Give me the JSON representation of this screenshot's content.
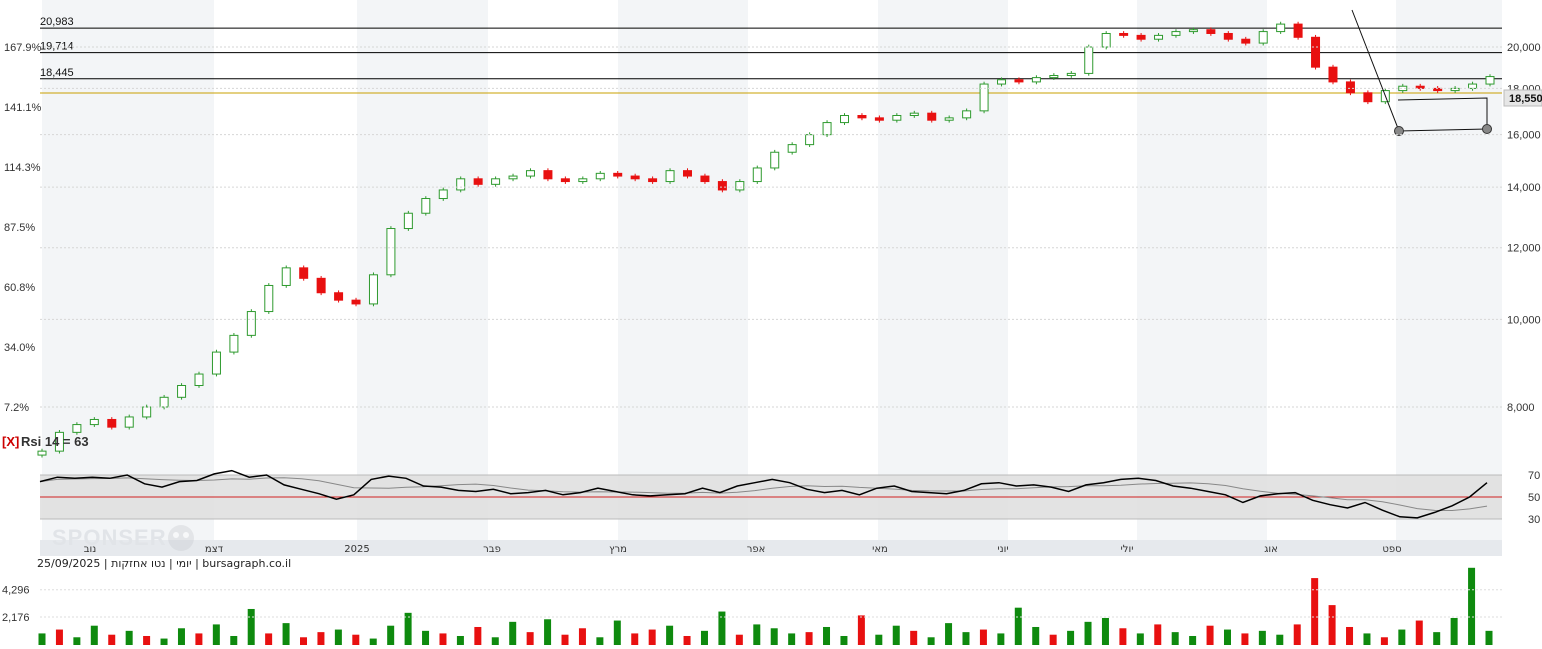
{
  "info_line": "יומי | נטו אחזקות | 25/09/2025 | bursagraph.co.il",
  "watermark": "SPONSER",
  "last_price": "18,550",
  "rsi_label": "Rsi 14 = 63",
  "rsi_close_mark": "[X]",
  "colors": {
    "up": "#2e9a2e",
    "down": "#e81010",
    "vol_up": "#0e8a0e",
    "vol_down": "#e81010",
    "level_line": "#000000",
    "last_line": "#c8a000",
    "rsi_mid": "#d02020",
    "band": "#dedede"
  },
  "chart_data": {
    "type": "candlestick",
    "price_axis": {
      "scale": "log",
      "ticks": [
        "8,000",
        "10,000",
        "12,000",
        "14,000",
        "16,000",
        "18,000",
        "20,000"
      ],
      "tick_values": [
        8000,
        10000,
        12000,
        14000,
        16000,
        18000,
        20000
      ]
    },
    "percent_axis": {
      "ticks": [
        "7.2%",
        "34.0%",
        "60.8%",
        "87.5%",
        "114.3%",
        "141.1%",
        "167.9%"
      ]
    },
    "levels": [
      {
        "label": "20,983",
        "value": 20983
      },
      {
        "label": "19,714",
        "value": 19714
      },
      {
        "label": "18,445",
        "value": 18445
      }
    ],
    "months": [
      "נוב",
      "דצמ",
      "2025",
      "פבר",
      "מרץ",
      "אפר",
      "מאי",
      "יוני",
      "יולי",
      "אוג",
      "ספט"
    ],
    "close_path": [
      7150,
      7500,
      7650,
      7750,
      7600,
      7800,
      8000,
      8200,
      8450,
      8700,
      9200,
      9600,
      10200,
      10900,
      11400,
      11100,
      10700,
      10500,
      10400,
      11200,
      12600,
      13100,
      13600,
      13900,
      14300,
      14100,
      14300,
      14400,
      14600,
      14300,
      14200,
      14300,
      14500,
      14400,
      14300,
      14200,
      14600,
      14400,
      14200,
      13900,
      14200,
      14700,
      15300,
      15600,
      16000,
      16500,
      16800,
      16700,
      16600,
      16800,
      16900,
      16600,
      16700,
      17000,
      18200,
      18400,
      18300,
      18500,
      18600,
      18700,
      20000,
      20700,
      20600,
      20400,
      20600,
      20800,
      20900,
      20700,
      20400,
      20200,
      20800,
      21200,
      20500,
      19000,
      18300,
      17800,
      17400,
      17900,
      18100,
      18000,
      17900,
      18000,
      18200,
      18550
    ],
    "rsi": {
      "period": 14,
      "value": 63,
      "axis_ticks": [
        "30",
        "50",
        "70"
      ],
      "series": [
        64,
        68,
        67,
        68,
        67,
        70,
        62,
        59,
        64,
        65,
        71,
        74,
        68,
        70,
        61,
        57,
        53,
        48,
        52,
        66,
        69,
        67,
        60,
        59,
        56,
        55,
        57,
        53,
        54,
        56,
        52,
        54,
        58,
        55,
        52,
        51,
        52,
        53,
        58,
        54,
        60,
        63,
        66,
        63,
        57,
        54,
        56,
        52,
        58,
        60,
        55,
        54,
        53,
        56,
        62,
        63,
        60,
        61,
        59,
        55,
        61,
        63,
        66,
        67,
        65,
        60,
        58,
        55,
        52,
        45,
        51,
        53,
        54,
        47,
        43,
        40,
        45,
        38,
        32,
        31,
        36,
        42,
        50,
        63
      ]
    },
    "volume": {
      "axis_ticks": [
        "2,176",
        "4,296"
      ],
      "axis_values": [
        2176,
        4296
      ],
      "bars": [
        900,
        1200,
        600,
        1500,
        800,
        1100,
        700,
        500,
        1300,
        900,
        1600,
        700,
        2800,
        900,
        1700,
        600,
        1000,
        1200,
        800,
        500,
        1500,
        2500,
        1100,
        900,
        700,
        1400,
        600,
        1800,
        1000,
        2000,
        800,
        1300,
        600,
        1900,
        900,
        1200,
        1500,
        700,
        1100,
        2600,
        800,
        1600,
        1300,
        900,
        1000,
        1400,
        700,
        2300,
        800,
        1500,
        1100,
        600,
        1700,
        1000,
        1200,
        900,
        2900,
        1400,
        800,
        1100,
        1800,
        2100,
        1300,
        900,
        1600,
        1000,
        700,
        1500,
        1200,
        900,
        1100,
        800,
        1600,
        5200,
        3100,
        1400,
        900,
        600,
        1200,
        1900,
        1000,
        2100,
        6000,
        1100
      ],
      "bar_up": [
        1,
        0,
        1,
        1,
        0,
        1,
        0,
        1,
        1,
        0,
        1,
        1,
        1,
        0,
        1,
        0,
        0,
        1,
        0,
        1,
        1,
        1,
        1,
        0,
        1,
        0,
        1,
        1,
        0,
        1,
        0,
        0,
        1,
        1,
        0,
        0,
        1,
        0,
        1,
        1,
        0,
        1,
        1,
        1,
        0,
        1,
        1,
        0,
        1,
        1,
        0,
        1,
        1,
        1,
        0,
        1,
        1,
        1,
        0,
        1,
        1,
        1,
        0,
        1,
        0,
        1,
        1,
        0,
        1,
        0,
        1,
        1,
        0,
        0,
        0,
        0,
        1,
        0,
        1,
        0,
        1,
        1,
        1,
        1
      ]
    }
  }
}
